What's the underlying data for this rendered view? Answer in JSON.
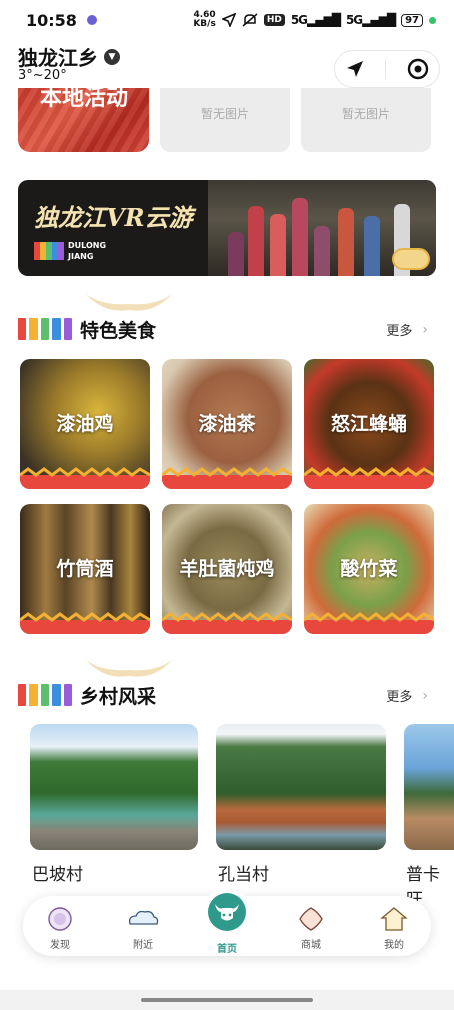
{
  "status_bar": {
    "time": "10:58",
    "net_speed_value": "4.60",
    "net_speed_unit": "KB/s",
    "hd": "HD",
    "signal_1": "5G",
    "signal_2": "5G",
    "battery": "97"
  },
  "header": {
    "location": "独龙江乡",
    "temperature": "3°~20°"
  },
  "activities": {
    "label": "本地活动",
    "no_image_1": "暂无图片",
    "no_image_2": "暂无图片"
  },
  "vr_banner": {
    "title": "独龙江VR云游",
    "sub_line1": "DULONG",
    "sub_line2": "JIANG"
  },
  "food_section": {
    "title": "特色美食",
    "more": "更多",
    "items": [
      {
        "label": "漆油鸡"
      },
      {
        "label": "漆油茶"
      },
      {
        "label": "怒江蜂蛹"
      },
      {
        "label": "竹筒酒"
      },
      {
        "label": "羊肚菌炖鸡"
      },
      {
        "label": "酸竹菜"
      }
    ]
  },
  "village_section": {
    "title": "乡村风采",
    "more": "更多",
    "items": [
      {
        "label": "巴坡村"
      },
      {
        "label": "孔当村"
      },
      {
        "label": "普卡旺"
      }
    ]
  },
  "bottom_nav": {
    "items": [
      {
        "label": "发现"
      },
      {
        "label": "附近"
      },
      {
        "label": "首页"
      },
      {
        "label": "商城"
      },
      {
        "label": "我的"
      }
    ],
    "active": "首页"
  },
  "colors": {
    "accent": "#2f9a8c",
    "rainbow": [
      "#e8473e",
      "#f3b233",
      "#5cbf6d",
      "#3c8fe0",
      "#9a5cd8"
    ]
  }
}
